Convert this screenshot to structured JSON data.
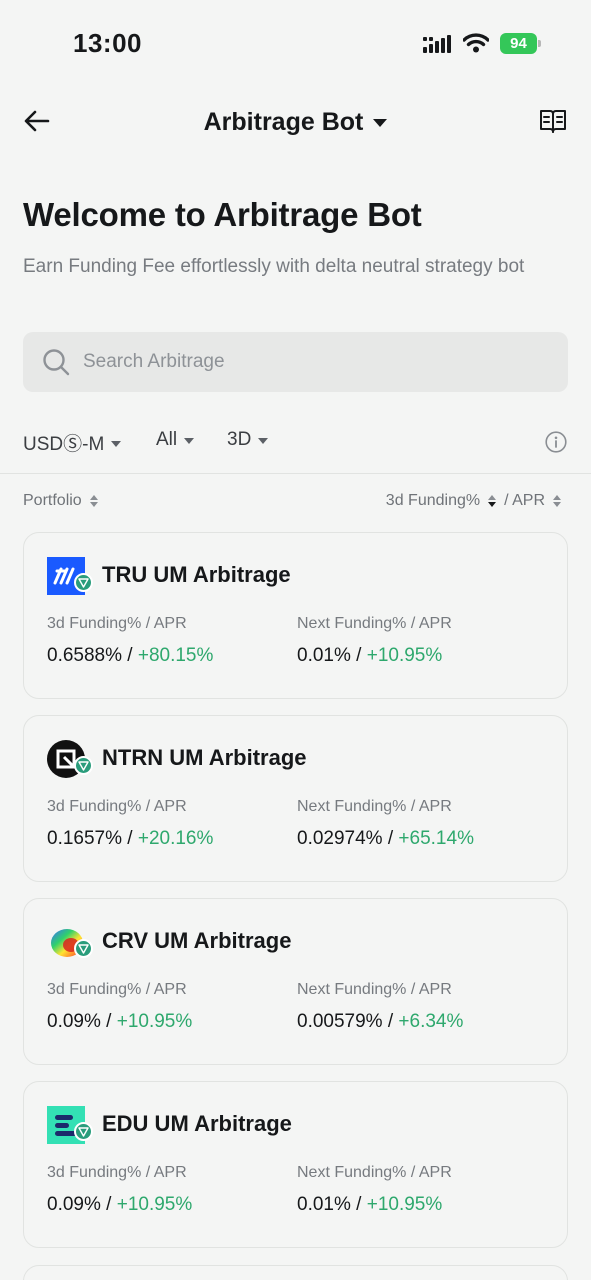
{
  "status_bar": {
    "time": "13:00",
    "battery": "94"
  },
  "nav": {
    "title": "Arbitrage Bot"
  },
  "header": {
    "title": "Welcome to Arbitrage Bot",
    "subtitle": "Earn Funding Fee effortlessly with delta neutral strategy bot"
  },
  "search": {
    "placeholder": "Search Arbitrage",
    "value": ""
  },
  "filters": {
    "margin": "USDⓈ-M",
    "scope": "All",
    "period": "3D"
  },
  "sort": {
    "left_label": "Portfolio",
    "right_label_1": "3d Funding%",
    "right_sep": "/ APR"
  },
  "cards": [
    {
      "title": "TRU UM Arbitrage",
      "icon": "tru-logo-icon",
      "left_label": "3d Funding% / APR",
      "left_value": "0.6588% / ",
      "left_apr": "+80.15%",
      "right_label": "Next Funding% / APR",
      "right_value": "0.01% / ",
      "right_apr": "+10.95%"
    },
    {
      "title": "NTRN UM Arbitrage",
      "icon": "ntrn-logo-icon",
      "left_label": "3d Funding% / APR",
      "left_value": "0.1657% / ",
      "left_apr": "+20.16%",
      "right_label": "Next Funding% / APR",
      "right_value": "0.02974% / ",
      "right_apr": "+65.14%"
    },
    {
      "title": "CRV UM Arbitrage",
      "icon": "crv-logo-icon",
      "left_label": "3d Funding% / APR",
      "left_value": "0.09% / ",
      "left_apr": "+10.95%",
      "right_label": "Next Funding% / APR",
      "right_value": "0.00579% / ",
      "right_apr": "+6.34%"
    },
    {
      "title": "EDU UM Arbitrage",
      "icon": "edu-logo-icon",
      "left_label": "3d Funding% / APR",
      "left_value": "0.09% / ",
      "left_apr": "+10.95%",
      "right_label": "Next Funding% / APR",
      "right_value": "0.01% / ",
      "right_apr": "+10.95%"
    }
  ],
  "colors": {
    "positive": "#2ea86d",
    "badge": "#2a9d7c",
    "battery": "#34c759"
  }
}
